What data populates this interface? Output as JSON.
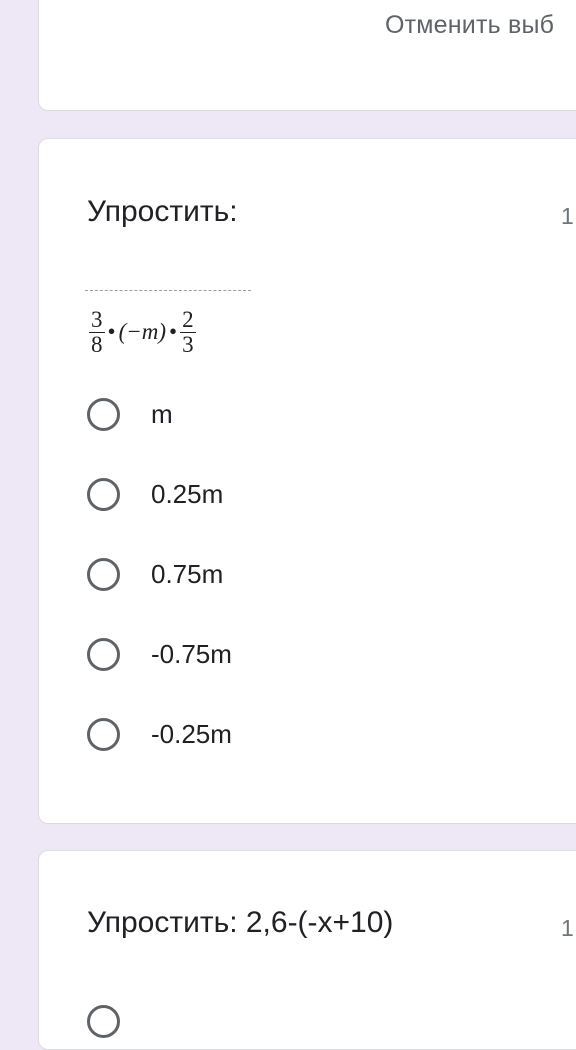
{
  "top_card": {
    "clear_selection_label": "Отменить выб"
  },
  "question1": {
    "title": "Упростить:",
    "points": "1",
    "formula": {
      "frac1_num": "3",
      "frac1_den": "8",
      "op1": "•",
      "middle": "(−m)",
      "op2": "•",
      "frac2_num": "2",
      "frac2_den": "3"
    },
    "options": [
      "m",
      "0.25m",
      "0.75m",
      "-0.75m",
      "-0.25m"
    ]
  },
  "question2": {
    "title": "Упростить: 2,6-(-x+10)",
    "points": "1"
  },
  "colors": {
    "background": "#ede7f6",
    "card": "#ffffff",
    "radio_border": "#5f6368",
    "text_primary": "#202124",
    "text_secondary": "#5f6368"
  },
  "icons": {
    "radio_unchecked": "radio-unchecked-icon"
  }
}
